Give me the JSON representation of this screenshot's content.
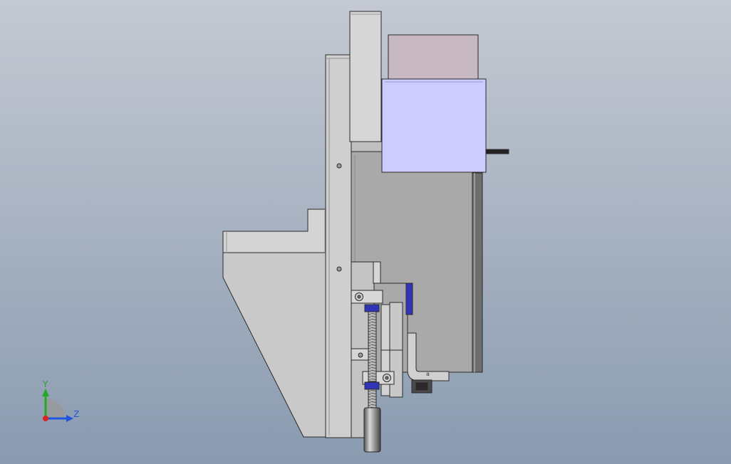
{
  "viewport": {
    "background_top": "#c4c9d2",
    "background_bottom": "#8a9bb0"
  },
  "colors": {
    "metal_light": "#d2d2d2",
    "metal_mid": "#c4c4c4",
    "metal_dark": "#a9a9a9",
    "edge": "#2a2a2a",
    "motor_housing": "#ccccff",
    "motor_cap": "#c8b8c2",
    "fastener_blue": "#2f34b8",
    "cable": "#222222",
    "axis_y": "#22aa22",
    "axis_z": "#2255dd",
    "axis_x": "#dd2222"
  },
  "triad": {
    "y_label": "Y",
    "z_label": "Z"
  }
}
